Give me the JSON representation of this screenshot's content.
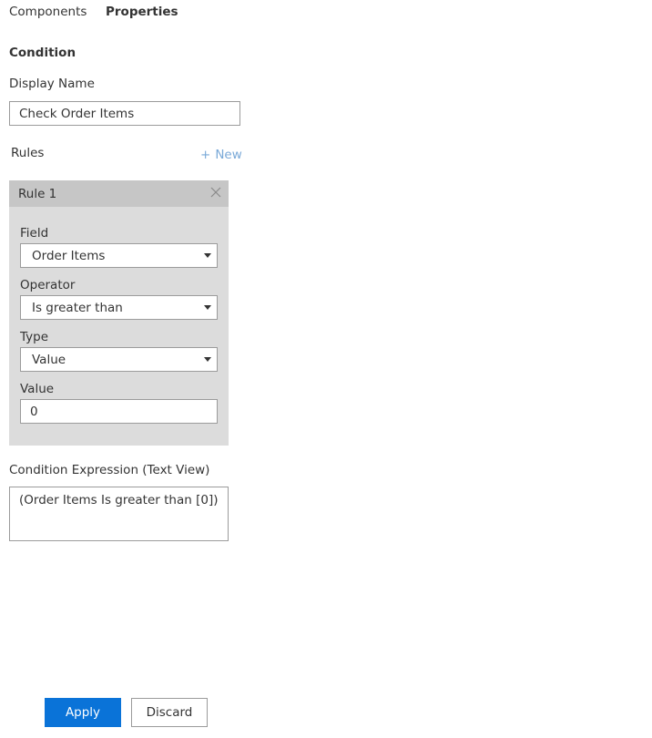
{
  "tabs": [
    {
      "label": "Components",
      "active": false
    },
    {
      "label": "Properties",
      "active": true
    }
  ],
  "section_title": "Condition",
  "display_name": {
    "label": "Display Name",
    "value": "Check Order Items"
  },
  "rules": {
    "label": "Rules",
    "new_label": "New",
    "new_icon": "plus-icon",
    "items": [
      {
        "title": "Rule 1",
        "close_icon": "close-icon",
        "field": {
          "label": "Field",
          "value": "Order Items"
        },
        "operator": {
          "label": "Operator",
          "value": "Is greater than"
        },
        "type": {
          "label": "Type",
          "value": "Value"
        },
        "value": {
          "label": "Value",
          "value": "0"
        }
      }
    ]
  },
  "expression": {
    "label": "Condition Expression (Text View)",
    "text": "(Order Items Is greater than [0])"
  },
  "buttons": {
    "apply": "Apply",
    "discard": "Discard"
  },
  "colors": {
    "accent": "#0a73d8",
    "link": "#7aa9d8",
    "panel": "#dcdcdc",
    "panel_header": "#c6c6c6"
  }
}
